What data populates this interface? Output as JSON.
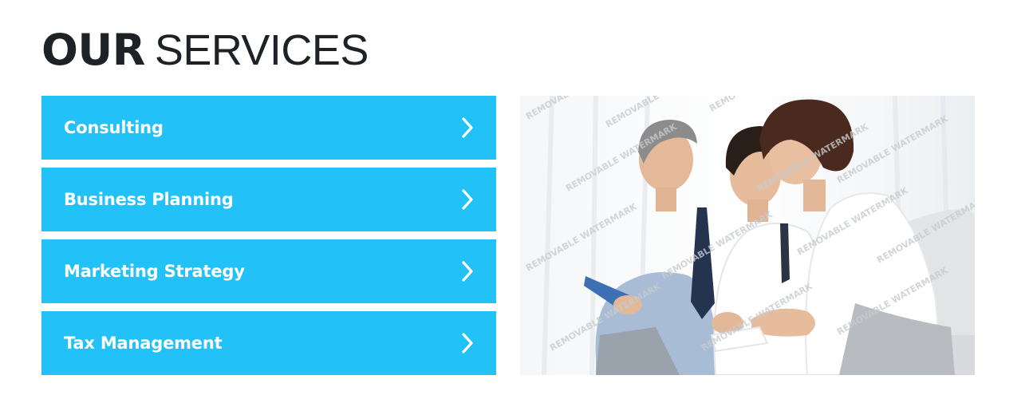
{
  "heading": {
    "bold": "OUR",
    "light": "SERVICES"
  },
  "services": [
    {
      "label": "Consulting",
      "icon": "chevron-right-icon"
    },
    {
      "label": "Business Planning",
      "icon": "chevron-right-icon"
    },
    {
      "label": "Marketing Strategy",
      "icon": "chevron-right-icon"
    },
    {
      "label": "Tax Management",
      "icon": "chevron-right-icon"
    }
  ],
  "photo": {
    "watermark": "REMOVABLE WATERMARK"
  },
  "colors": {
    "accent": "#22c1f7",
    "heading": "#1e2227"
  }
}
